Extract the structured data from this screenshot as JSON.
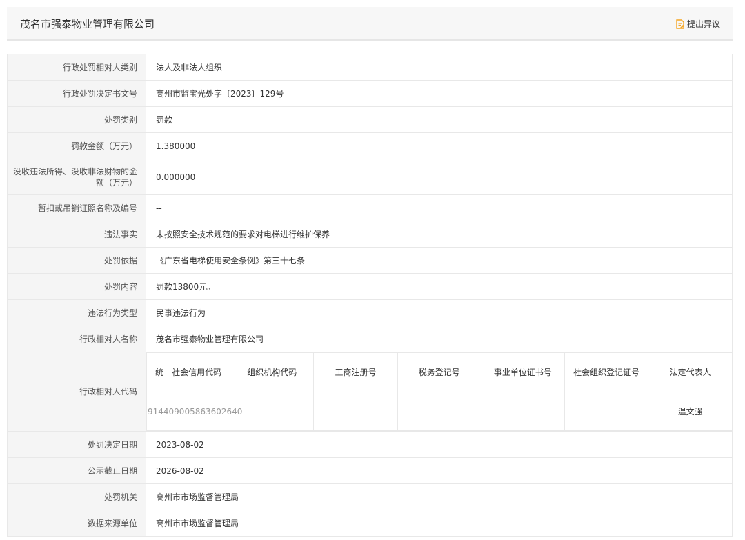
{
  "header": {
    "company_name": "茂名市强泰物业管理有限公司",
    "objection_label": "提出异议",
    "objection_icon": "document-edit-icon",
    "accent_color": "#f5a623"
  },
  "fields": {
    "party_type": {
      "label": "行政处罚相对人类别",
      "value": "法人及非法人组织"
    },
    "decision_no": {
      "label": "行政处罚决定书文号",
      "value": "高州市监宝光处字〔2023〕129号"
    },
    "penalty_type": {
      "label": "处罚类别",
      "value": "罚款"
    },
    "fine_amount": {
      "label": "罚款金额（万元）",
      "value": "1.380000"
    },
    "confiscation": {
      "label": "没收违法所得、没收非法财物的金额（万元）",
      "value": "0.000000"
    },
    "license_suspension": {
      "label": "暂扣或吊销证照名称及编号",
      "value": "--"
    },
    "violation_facts": {
      "label": "违法事实",
      "value": "未按照安全技术规范的要求对电梯进行维护保养"
    },
    "legal_basis": {
      "label": "处罚依据",
      "value": "《广东省电梯使用安全条例》第三十七条"
    },
    "penalty_content": {
      "label": "处罚内容",
      "value": "罚款13800元。"
    },
    "violation_type": {
      "label": "违法行为类型",
      "value": "民事违法行为"
    },
    "party_name": {
      "label": "行政相对人名称",
      "value": "茂名市强泰物业管理有限公司"
    },
    "decision_date": {
      "label": "处罚决定日期",
      "value": "2023-08-02"
    },
    "publicity_end": {
      "label": "公示截止日期",
      "value": "2026-08-02"
    },
    "authority": {
      "label": "处罚机关",
      "value": "高州市市场监督管理局"
    },
    "data_source": {
      "label": "数据来源单位",
      "value": "高州市市场监督管理局"
    }
  },
  "party_codes": {
    "label": "行政相对人代码",
    "headers": [
      "统一社会信用代码",
      "组织机构代码",
      "工商注册号",
      "税务登记号",
      "事业单位证书号",
      "社会组织登记证号",
      "法定代表人"
    ],
    "values": [
      "914409005863602640",
      "--",
      "--",
      "--",
      "--",
      "--",
      "温文强"
    ]
  }
}
